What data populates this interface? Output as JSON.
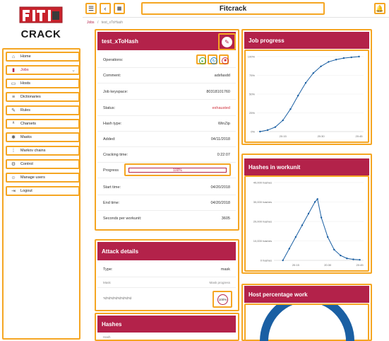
{
  "app": {
    "title": "Fitcrack"
  },
  "logo": {
    "text": "CRACK"
  },
  "sidebar": {
    "items": [
      {
        "label": "Home",
        "icon": "home-icon"
      },
      {
        "label": "Jobs",
        "icon": "briefcase-icon",
        "active": true
      },
      {
        "label": "Hosts",
        "icon": "desktop-icon"
      },
      {
        "label": "Dictionaries",
        "icon": "list-icon"
      },
      {
        "label": "Rules",
        "icon": "wrench-icon"
      },
      {
        "label": "Charsets",
        "icon": "charset-icon"
      },
      {
        "label": "Masks",
        "icon": "mask-icon"
      },
      {
        "label": "Markov chains",
        "icon": "chain-icon"
      },
      {
        "label": "Control",
        "icon": "gear-icon"
      },
      {
        "label": "Manage users",
        "icon": "users-icon"
      },
      {
        "label": "Logout",
        "icon": "logout-icon"
      }
    ]
  },
  "breadcrumb": {
    "root": "Jobs",
    "separator": "/",
    "current": "test_xToHash"
  },
  "job": {
    "title": "test_xToHash",
    "rows": [
      {
        "label": "Operations:",
        "value": ""
      },
      {
        "label": "Comment:",
        "value": "adsfasdd"
      },
      {
        "label": "Job keyspace:",
        "value": "80318101760"
      },
      {
        "label": "Status:",
        "value": "exhausted",
        "color": "#d0303c"
      },
      {
        "label": "Hash type:",
        "value": "WinZip"
      },
      {
        "label": "Added:",
        "value": "04/11/2018"
      },
      {
        "label": "Cracking time:",
        "value": "0:22:07"
      },
      {
        "label": "Progress",
        "value": ""
      },
      {
        "label": "Start time:",
        "value": "04/20/2018"
      },
      {
        "label": "End time:",
        "value": "04/20/2018"
      },
      {
        "label": "Seconds per workunit:",
        "value": "3605"
      }
    ],
    "progress": {
      "value": 100,
      "text": "100%"
    }
  },
  "attack": {
    "title": "Attack details",
    "type_label": "Type:",
    "type_value": "mask",
    "col_mask": "Mask",
    "col_progress": "Mask progress",
    "mask_value": "?d?d?d?d?d?d?d?d",
    "mask_progress": "100%"
  },
  "hashes": {
    "title": "Hashes",
    "col_hash": "Hash"
  },
  "colors": {
    "accent": "#b3224a",
    "chart": "#1a5fa3",
    "highlight": "#f5a623"
  },
  "chart_data": [
    {
      "type": "line",
      "title": "Job progress",
      "y_ticks": [
        "0%",
        "25%",
        "50%",
        "75%",
        "100%"
      ],
      "x_ticks": [
        "20:15",
        "20:30",
        "20:45"
      ],
      "ylim": [
        0,
        100
      ],
      "xlim": [
        20.08,
        20.78
      ],
      "x": [
        20.1,
        20.15,
        20.2,
        20.25,
        20.3,
        20.35,
        20.4,
        20.45,
        20.5,
        20.55,
        20.6,
        20.65,
        20.7,
        20.75
      ],
      "y": [
        0,
        2,
        6,
        15,
        30,
        48,
        65,
        78,
        87,
        93,
        96,
        98,
        99,
        100
      ]
    },
    {
      "type": "line",
      "title": "Hashes in workunit",
      "y_ticks": [
        "0 hashes",
        "10,000 hashes",
        "20,000 hashes",
        "30,000 hashes",
        "40,000 hashes"
      ],
      "x_ticks": [
        "20:15",
        "20:30",
        "20:45"
      ],
      "ylim": [
        0,
        40000
      ],
      "xlim": [
        20.08,
        20.78
      ],
      "x": [
        20.15,
        20.2,
        20.25,
        20.3,
        20.35,
        20.4,
        20.42,
        20.45,
        20.5,
        20.55,
        20.6,
        20.65,
        20.7,
        20.75
      ],
      "y": [
        0,
        6000,
        12000,
        18000,
        24000,
        30000,
        31500,
        22000,
        12000,
        5500,
        2500,
        1000,
        500,
        300
      ]
    }
  ],
  "host_chart": {
    "title": "Host percentage work"
  }
}
